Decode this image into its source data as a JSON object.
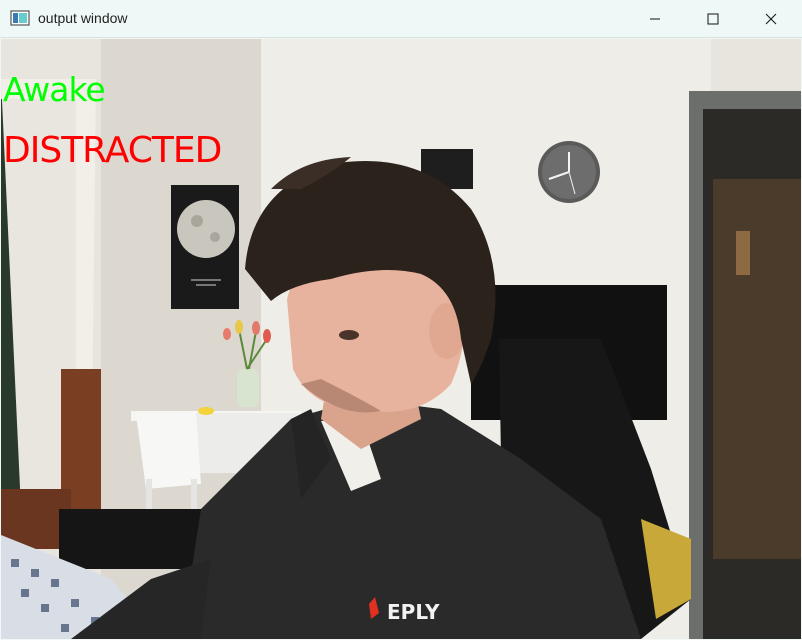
{
  "window": {
    "title": "output window",
    "controls": [
      "minimize",
      "maximize",
      "close"
    ]
  },
  "overlay": {
    "awake_label": "Awake",
    "awake_color": "#00ff00",
    "attention_label": "DISTRACTED",
    "attention_color": "#ff0000"
  },
  "icons": [
    "app-icon",
    "minimize-icon",
    "maximize-icon",
    "close-icon"
  ],
  "shirt_logo": "EPLY"
}
